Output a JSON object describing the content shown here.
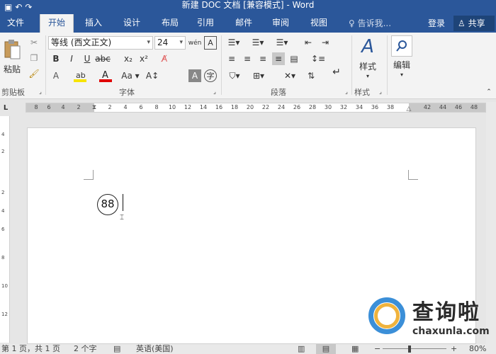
{
  "window": {
    "title": "新建 DOC 文档 [兼容模式] - Word"
  },
  "tabs": [
    {
      "label": "文件"
    },
    {
      "label": "开始"
    },
    {
      "label": "插入"
    },
    {
      "label": "设计"
    },
    {
      "label": "布局"
    },
    {
      "label": "引用"
    },
    {
      "label": "邮件"
    },
    {
      "label": "审阅"
    },
    {
      "label": "视图"
    }
  ],
  "active_tab": "开始",
  "tell_me": {
    "placeholder": "告诉我..."
  },
  "account": {
    "login_label": "登录",
    "share_label": "共享"
  },
  "ribbon": {
    "clipboard": {
      "paste_label": "粘贴",
      "group_label": "剪贴板"
    },
    "font": {
      "font_name": "等线 (西文正文)",
      "font_size": "24",
      "group_label": "字体"
    },
    "paragraph": {
      "group_label": "段落"
    },
    "styles": {
      "styles_label": "样式",
      "group_label": "样式"
    },
    "editing": {
      "editing_label": "编辑"
    }
  },
  "ruler": {
    "ticks": [
      "8",
      "6",
      "4",
      "2",
      "2",
      "4",
      "6",
      "8",
      "10",
      "12",
      "14",
      "16",
      "18",
      "20",
      "22",
      "24",
      "26",
      "28",
      "30",
      "32",
      "34",
      "36",
      "38",
      "42",
      "44",
      "46",
      "48"
    ]
  },
  "vertical_ruler": {
    "ticks": [
      "4",
      "2",
      "2",
      "4",
      "6",
      "8",
      "10",
      "12"
    ]
  },
  "document": {
    "circled_text": "88"
  },
  "status": {
    "page": "第 1 页，共 1 页",
    "words": "2 个字",
    "language": "英语(美国)",
    "zoom": "80%"
  },
  "watermark": {
    "text": "查询啦",
    "url": "chaxunla.com"
  },
  "colors": {
    "accent": "#2b579a",
    "highlight": "#f7e400",
    "font_color": "#e00000"
  }
}
